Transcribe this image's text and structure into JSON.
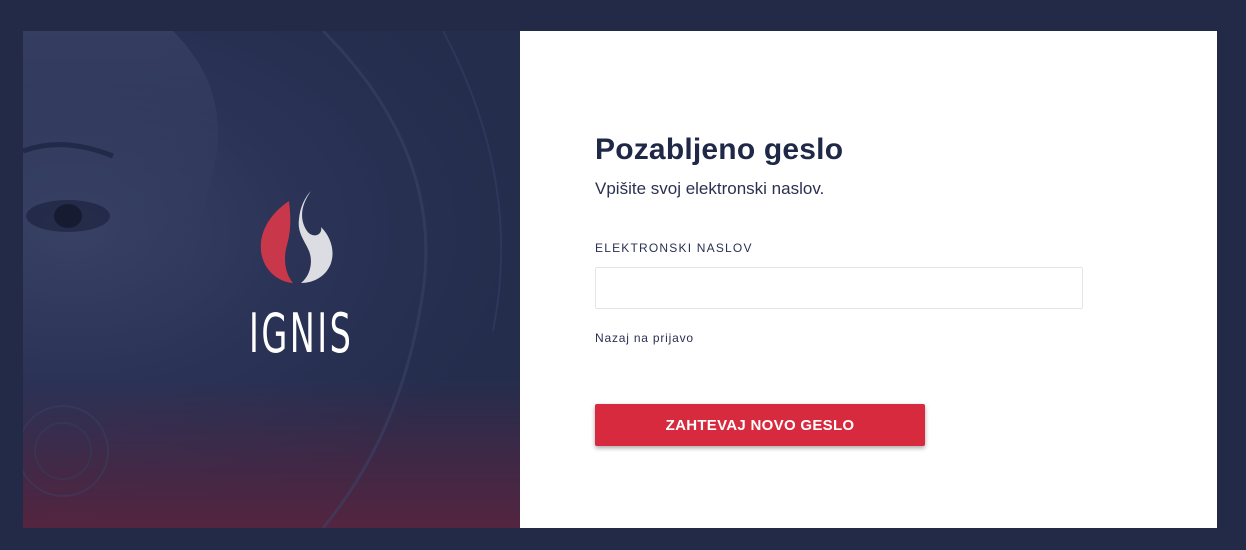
{
  "brand": {
    "name": "IGNIS",
    "colors": {
      "flame_red": "#c8374a",
      "flame_white": "#dcdde2"
    }
  },
  "form": {
    "title": "Pozabljeno geslo",
    "subtitle": "Vpišite svoj elektronski naslov.",
    "email_label": "ELEKTRONSKI NASLOV",
    "email_value": "",
    "email_placeholder": "",
    "back_link": "Nazaj na prijavo",
    "submit_label": "ZAHTEVAJ NOVO GESLO"
  },
  "theme": {
    "background": "#222a47",
    "panel": "#ffffff",
    "accent": "#d72a3f",
    "text": "#202847"
  }
}
